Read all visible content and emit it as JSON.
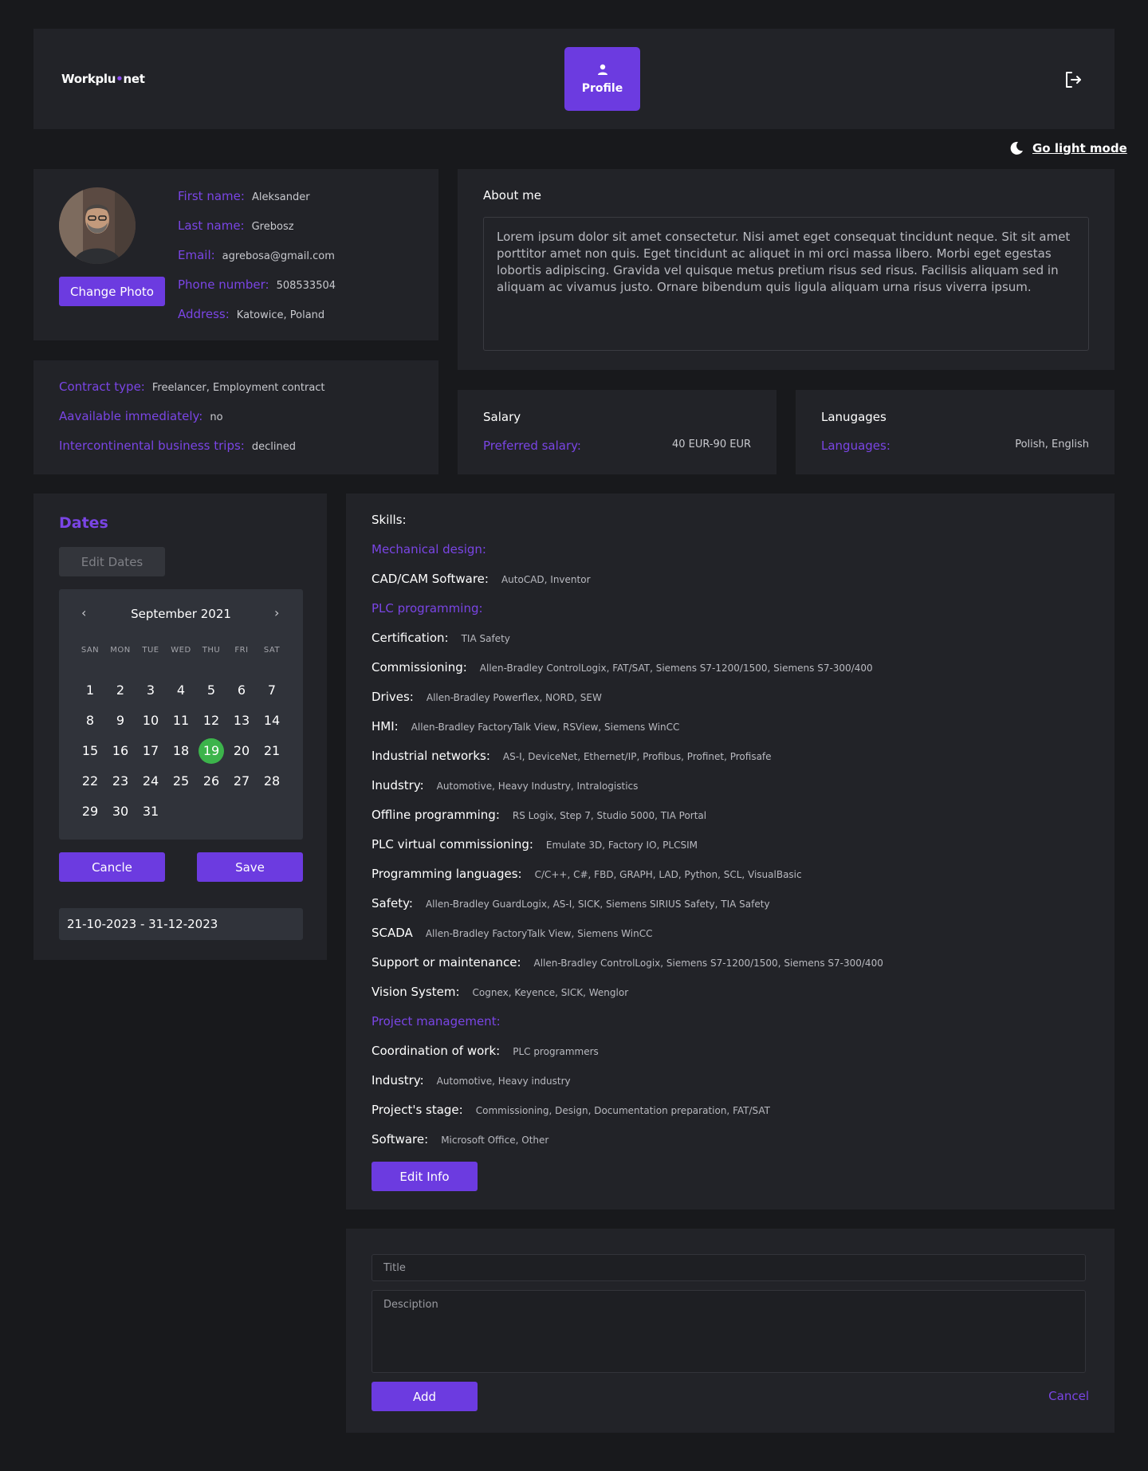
{
  "header": {
    "logo": "Workplu",
    "logo_dot": "•",
    "logo_suffix": "net",
    "profile_tab": "Profile"
  },
  "theme_toggle": "Go light mode",
  "personal": {
    "change_photo": "Change Photo",
    "fields": [
      {
        "label": "First name:",
        "value": "Aleksander"
      },
      {
        "label": "Last name:",
        "value": "Grebosz"
      },
      {
        "label": "Email:",
        "value": "agrebosa@gmail.com"
      },
      {
        "label": "Phone number:",
        "value": "508533504"
      },
      {
        "label": "Address:",
        "value": "Katowice, Poland"
      }
    ]
  },
  "about": {
    "title": "About me",
    "text": "Lorem ipsum dolor sit amet consectetur. Nisi amet eget consequat tincidunt neque. Sit sit amet porttitor amet non quis. Eget tincidunt ac aliquet in mi orci massa libero. Morbi eget egestas lobortis adipiscing. Gravida vel quisque metus pretium risus sed risus. Facilisis aliquam sed in aliquam ac vivamus justo. Ornare bibendum quis ligula aliquam urna risus viverra ipsum."
  },
  "contract": [
    {
      "label": "Contract type:",
      "value": "Freelancer, Employment contract"
    },
    {
      "label": "Aavailable immediately:",
      "value": "no"
    },
    {
      "label": "Intercontinental business trips:",
      "value": "declined"
    }
  ],
  "salary": {
    "title": "Salary",
    "label": "Preferred salary:",
    "value": "40 EUR-90 EUR"
  },
  "languages": {
    "title": "Lanugages",
    "label": "Languages:",
    "value": "Polish, English"
  },
  "dates": {
    "title": "Dates",
    "edit_label": "Edit Dates",
    "month": "September 2021",
    "prev": "‹",
    "next": "›",
    "weekdays": [
      "SAN",
      "MON",
      "TUE",
      "WED",
      "THU",
      "FRI",
      "SAT"
    ],
    "selected_day": 19,
    "cancel_label": "Cancle",
    "save_label": "Save",
    "range": "21-10-2023 - 31-12-2023"
  },
  "skills": {
    "header": "Skills:",
    "items": [
      {
        "type": "cat",
        "label": "Mechanical design:"
      },
      {
        "type": "row",
        "label": "CAD/CAM Software:",
        "value": "AutoCAD, Inventor"
      },
      {
        "type": "cat",
        "label": "PLC programming:"
      },
      {
        "type": "row",
        "label": "Certification:",
        "value": "TIA Safety"
      },
      {
        "type": "row",
        "label": "Commissioning:",
        "value": "Allen-Bradley ControlLogix, FAT/SAT, Siemens S7-1200/1500, Siemens S7-300/400"
      },
      {
        "type": "row",
        "label": "Drives:",
        "value": "Allen-Bradley Powerflex, NORD, SEW"
      },
      {
        "type": "row",
        "label": "HMI:",
        "value": "Allen-Bradley FactoryTalk View, RSView, Siemens WinCC"
      },
      {
        "type": "row",
        "label": "Industrial networks:",
        "value": "AS-I, DeviceNet, Ethernet/IP, Profibus, Profinet, Profisafe"
      },
      {
        "type": "row",
        "label": "Inudstry:",
        "value": "Automotive, Heavy Industry, Intralogistics"
      },
      {
        "type": "row",
        "label": "Offline programming:",
        "value": "RS Logix, Step 7, Studio 5000, TIA Portal"
      },
      {
        "type": "row",
        "label": "PLC virtual commissioning:",
        "value": "Emulate 3D, Factory IO, PLCSIM"
      },
      {
        "type": "row",
        "label": "Programming languages:",
        "value": "C/C++, C#, FBD, GRAPH, LAD, Python, SCL, VisualBasic"
      },
      {
        "type": "row",
        "label": "Safety:",
        "value": "Allen-Bradley GuardLogix, AS-I, SICK, Siemens SIRIUS Safety, TIA Safety"
      },
      {
        "type": "row",
        "label": "SCADA",
        "value": "Allen-Bradley FactoryTalk View, Siemens WinCC"
      },
      {
        "type": "row",
        "label": "Support or maintenance:",
        "value": "Allen-Bradley ControlLogix, Siemens S7-1200/1500, Siemens S7-300/400"
      },
      {
        "type": "row",
        "label": "Vision System:",
        "value": "Cognex, Keyence, SICK, Wenglor"
      },
      {
        "type": "cat",
        "label": "Project management:"
      },
      {
        "type": "row",
        "label": "Coordination of work:",
        "value": "PLC programmers"
      },
      {
        "type": "row",
        "label": "Industry:",
        "value": "Automotive, Heavy industry"
      },
      {
        "type": "row",
        "label": "Project's stage:",
        "value": "Commissioning, Design, Documentation preparation, FAT/SAT"
      },
      {
        "type": "row",
        "label": "Software:",
        "value": "Microsoft Office, Other"
      }
    ],
    "edit_label": "Edit Info"
  },
  "add_form": {
    "title_placeholder": "Title",
    "desc_placeholder": "Desciption",
    "add_label": "Add",
    "cancel_label": "Cancel"
  },
  "colors": {
    "accent": "#6c3be0",
    "accent_text": "#7a45e5",
    "selected_day": "#3cb44b",
    "background": "#18191c",
    "card": "#222328"
  }
}
